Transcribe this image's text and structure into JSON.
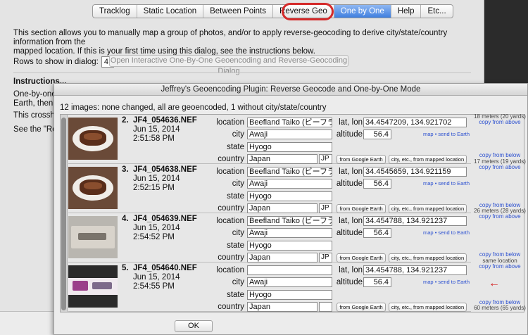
{
  "tabs": [
    {
      "label": "Tracklog",
      "selected": false
    },
    {
      "label": "Static Location",
      "selected": false
    },
    {
      "label": "Between Points",
      "selected": false
    },
    {
      "label": "Reverse Geo",
      "selected": false
    },
    {
      "label": "One by One",
      "selected": true
    },
    {
      "label": "Help",
      "selected": false
    },
    {
      "label": "Etc...",
      "selected": false
    }
  ],
  "background": {
    "intro_line1": "This section allows you to manually map a group of photos, and/or to apply reverse-geocoding to derive city/state/country information from the",
    "intro_line2": "mapped location. If this is your first time using this dialog, see the instructions below.",
    "rows_label": "Rows to show in dialog:",
    "rows_value": "4",
    "open_button": "Open Interactive One-By-One Geoencoding and Reverse-Geocoding Dialog",
    "instructions_title": "Instructions...",
    "instr_a": "One-by-one",
    "instr_b": "Earth, then c",
    "instr_c": "This crossha",
    "instr_d": "See the \"Reve"
  },
  "dialog": {
    "title": "Jeffrey's Geoencoding Plugin: Reverse Geocode and One-by-One Mode",
    "summary": "12 images: none changed, all are geoencoded, 1 without city/state/country",
    "ok_label": "OK"
  },
  "labels": {
    "location": "location",
    "city": "city",
    "state": "state",
    "country": "country",
    "latlon": "lat, lon",
    "altitude": "altitude",
    "from_google_earth": "from Google Earth",
    "city_from_map": "city, etc., from mapped location",
    "map_link": "map",
    "send_to_earth": "send to Earth",
    "copy_from_below": "copy from below",
    "copy_from_above": "copy from above"
  },
  "photos": [
    {
      "num": "2.",
      "filename": "JF4_054636.NEF",
      "date": "Jun 15, 2014",
      "time": "2:51:58  PM",
      "location": "Beefland Taiko (ビーフランド",
      "city": "Awaji",
      "state": "Hyogo",
      "country": "Japan",
      "country_code": "JP",
      "latlon": "34.4547209, 134.921702",
      "altitude": "56.4",
      "thumb": "steak"
    },
    {
      "num": "3.",
      "filename": "JF4_054638.NEF",
      "date": "Jun 15, 2014",
      "time": "2:52:15  PM",
      "location": "Beefland Taiko (ビーフランド",
      "city": "Awaji",
      "state": "Hyogo",
      "country": "Japan",
      "country_code": "JP",
      "latlon": "34.4545659, 134.921159",
      "altitude": "56.4",
      "thumb": "steak"
    },
    {
      "num": "4.",
      "filename": "JF4_054639.NEF",
      "date": "Jun 15, 2014",
      "time": "2:54:52  PM",
      "location": "Beefland Taiko (ビーフランド",
      "city": "Awaji",
      "state": "Hyogo",
      "country": "Japan",
      "country_code": "JP",
      "latlon": "34.454788, 134.921237",
      "altitude": "56.4",
      "thumb": "sign"
    },
    {
      "num": "5.",
      "filename": "JF4_054640.NEF",
      "date": "Jun 15, 2014",
      "time": "2:54:55  PM",
      "location": "",
      "city": "Awaji",
      "state": "Hyogo",
      "country": "Japan",
      "country_code": "",
      "latlon": "34.454788, 134.921237",
      "altitude": "56.4",
      "thumb": "banner"
    }
  ],
  "distances": {
    "d1": "18 meters (20 yards)",
    "d2": "17 meters (19 yards)",
    "d3": "26 meters (28 yards)",
    "d4": "same location",
    "d5": "60 meters (65 yards)"
  },
  "colors": {
    "accent": "#3f7fe0",
    "highlight": "#d42a2a",
    "link": "#2a4fd0"
  },
  "icons": {
    "indicator": "left-arrow-icon"
  }
}
